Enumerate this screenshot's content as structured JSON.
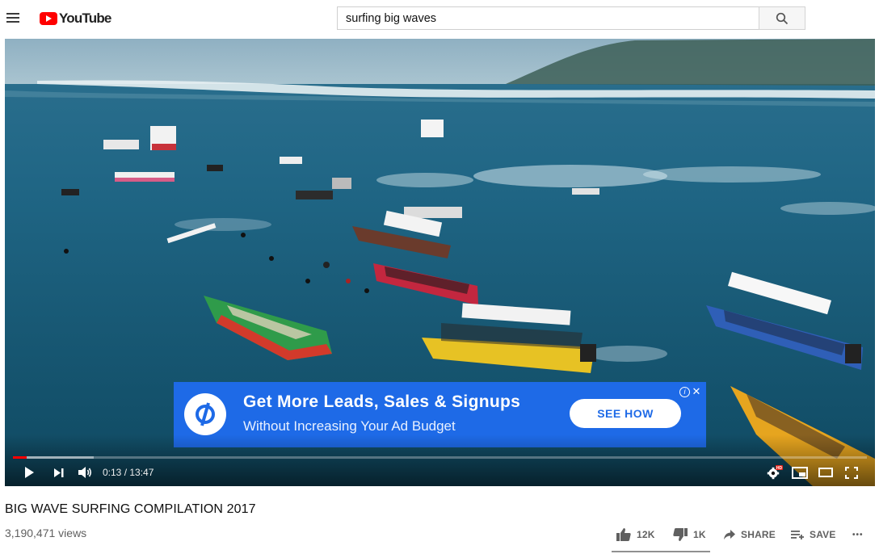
{
  "header": {
    "logo_text": "YouTube",
    "search_value": "surfing big waves",
    "icons": [
      "menu-icon",
      "youtube-logo-icon",
      "search-icon"
    ]
  },
  "ad": {
    "title": "Get More Leads, Sales & Signups",
    "subtitle": "Without Increasing Your Ad Budget",
    "cta": "SEE HOW",
    "info_symbol": "i",
    "close_symbol": "✕",
    "background_color": "#1e6ae7"
  },
  "player": {
    "current_time": "0:13",
    "duration": "13:47",
    "time_display": "0:13 / 13:47",
    "progress_fraction": 0.016,
    "buffered_fraction": 0.095,
    "hd_badge": "HD",
    "progress_color": "#ff0000"
  },
  "video": {
    "title": "BIG WAVE SURFING COMPILATION 2017",
    "views": "3,190,471 views"
  },
  "actions": {
    "likes": "12K",
    "dislikes": "1K",
    "share": "SHARE",
    "save": "SAVE",
    "more": "•••",
    "like_ratio": 0.92
  }
}
